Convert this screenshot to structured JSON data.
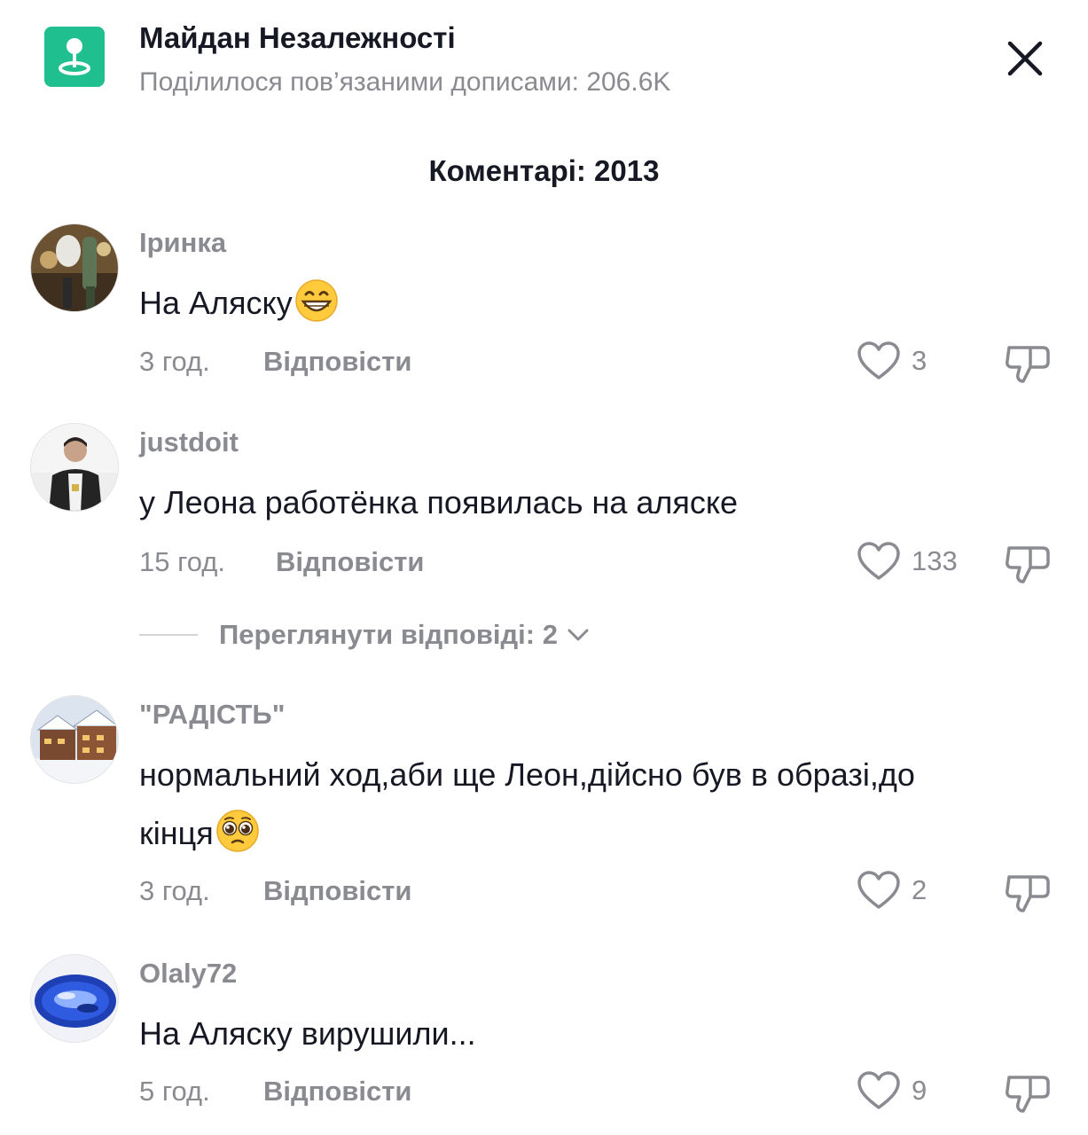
{
  "header": {
    "location_title": "Майдан Незалежності",
    "location_subtitle": "Поділилося пов’язаними дописами: 206.6K",
    "location_icon": "location-pin-icon",
    "close_icon": "close-icon"
  },
  "comments_count_label": "Коментарі: 2013",
  "comments": [
    {
      "username": "Іринка",
      "text": "На Аляску",
      "emoji": "grinning-face-emoji",
      "time": "3 год.",
      "reply_label": "Відповісти",
      "likes": "3"
    },
    {
      "username": "justdoit",
      "text": "у Леона работёнка появилась на аляске",
      "time": "15 год.",
      "reply_label": "Відповісти",
      "likes": "133"
    },
    {
      "username": "\"РАДІСТЬ\"",
      "text": "нормальний ход,аби ще Леон,дійсно був в образі,до кінця",
      "emoji": "pleading-face-emoji",
      "time": "3 год.",
      "reply_label": "Відповісти",
      "likes": "2"
    },
    {
      "username": "Olaly72",
      "text": "На Аляску вирушили...",
      "time": "5 год.",
      "reply_label": "Відповісти",
      "likes": "9"
    }
  ],
  "view_replies_label": "Переглянути відповіді: 2",
  "colors": {
    "accent_green": "#1fbf8f",
    "muted_text": "#8a8b91",
    "primary_text": "#161823"
  }
}
